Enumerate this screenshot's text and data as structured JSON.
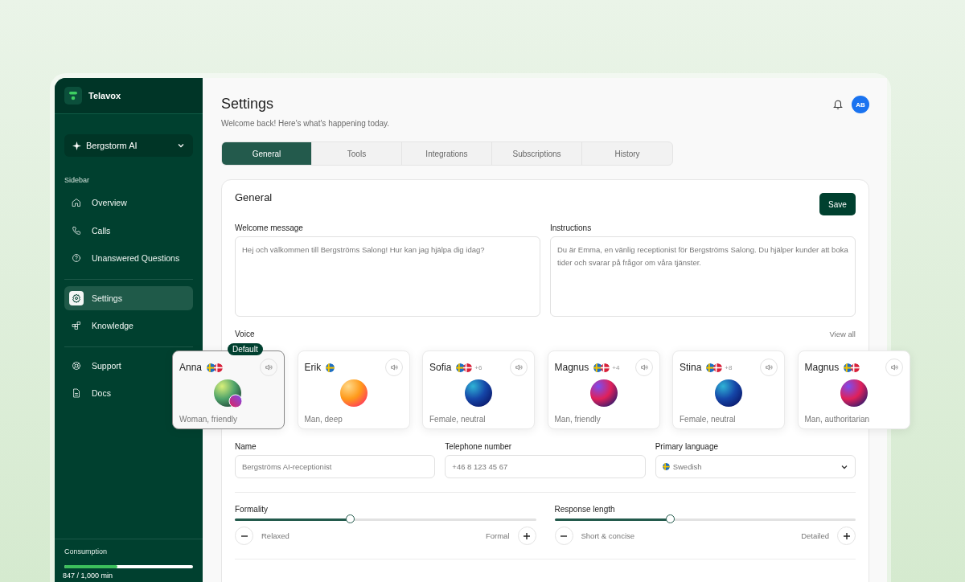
{
  "brand": {
    "name": "Telavox"
  },
  "workspace": {
    "label": "Bergstorm AI"
  },
  "sidebar": {
    "heading": "Sidebar",
    "groups": [
      [
        {
          "label": "Overview",
          "selected": false
        },
        {
          "label": "Calls",
          "selected": false
        },
        {
          "label": "Unanswered Questions",
          "selected": false
        }
      ],
      [
        {
          "label": "Settings",
          "selected": true
        },
        {
          "label": "Knowledge",
          "selected": false
        }
      ],
      [
        {
          "label": "Support",
          "selected": false
        },
        {
          "label": "Docs",
          "selected": false
        }
      ]
    ],
    "consumption": {
      "label": "Consumption",
      "level": 0.41,
      "reading": "847 / 1,000 min"
    }
  },
  "header": {
    "title": "Settings",
    "subtitle": "Welcome back! Here's what's happening today.",
    "avatar": "AB"
  },
  "tabs": [
    {
      "label": "General",
      "selected": true
    },
    {
      "label": "Tools",
      "selected": false
    },
    {
      "label": "Integrations",
      "selected": false
    },
    {
      "label": "Subscriptions",
      "selected": false
    },
    {
      "label": "History",
      "selected": false
    }
  ],
  "general": {
    "title": "General",
    "save": "Save",
    "welcome": {
      "label": "Welcome message",
      "value": "Hej och välkommen till Bergströms Salong! Hur kan jag hjälpa dig idag?"
    },
    "instructions": {
      "label": "Instructions",
      "value": "Du är Emma, en vänlig receptionist för Bergströms Salong. Du hjälper kunder att boka tider och svarar på frågor om våra tjänster."
    },
    "voice": {
      "label": "Voice",
      "view_all": "View all",
      "cards": [
        {
          "name": "Anna",
          "description": "Woman, friendly",
          "selected": true,
          "badge": "Default"
        },
        {
          "name": "Erik",
          "description": "Man, deep",
          "selected": false
        },
        {
          "name": "Sofia",
          "extra": "+6",
          "description": "Female, neutral",
          "selected": false
        },
        {
          "name": "Magnus",
          "extra": "+4",
          "description": "Man, friendly",
          "selected": false
        },
        {
          "name": "Stina",
          "extra": "+8",
          "description": "Female, neutral",
          "selected": false
        },
        {
          "name": "Magnus",
          "description": "Man, authoritarian",
          "selected": false
        }
      ]
    },
    "fields": [
      {
        "kind": "text",
        "label": "Name",
        "placeholder": "Bergströms AI-receptionist"
      },
      {
        "kind": "text",
        "label": "Telephone number",
        "placeholder": "+46 8 123 45 67"
      },
      {
        "kind": "select",
        "label": "Primary language",
        "value": "Swedish"
      }
    ],
    "sliders": [
      {
        "label": "Formality",
        "level": 0.385,
        "min_label": "Relaxed",
        "max_label": "Formal"
      },
      {
        "label": "Response length",
        "level": 0.385,
        "min_label": "Short & concise",
        "max_label": "Detailed"
      }
    ]
  }
}
